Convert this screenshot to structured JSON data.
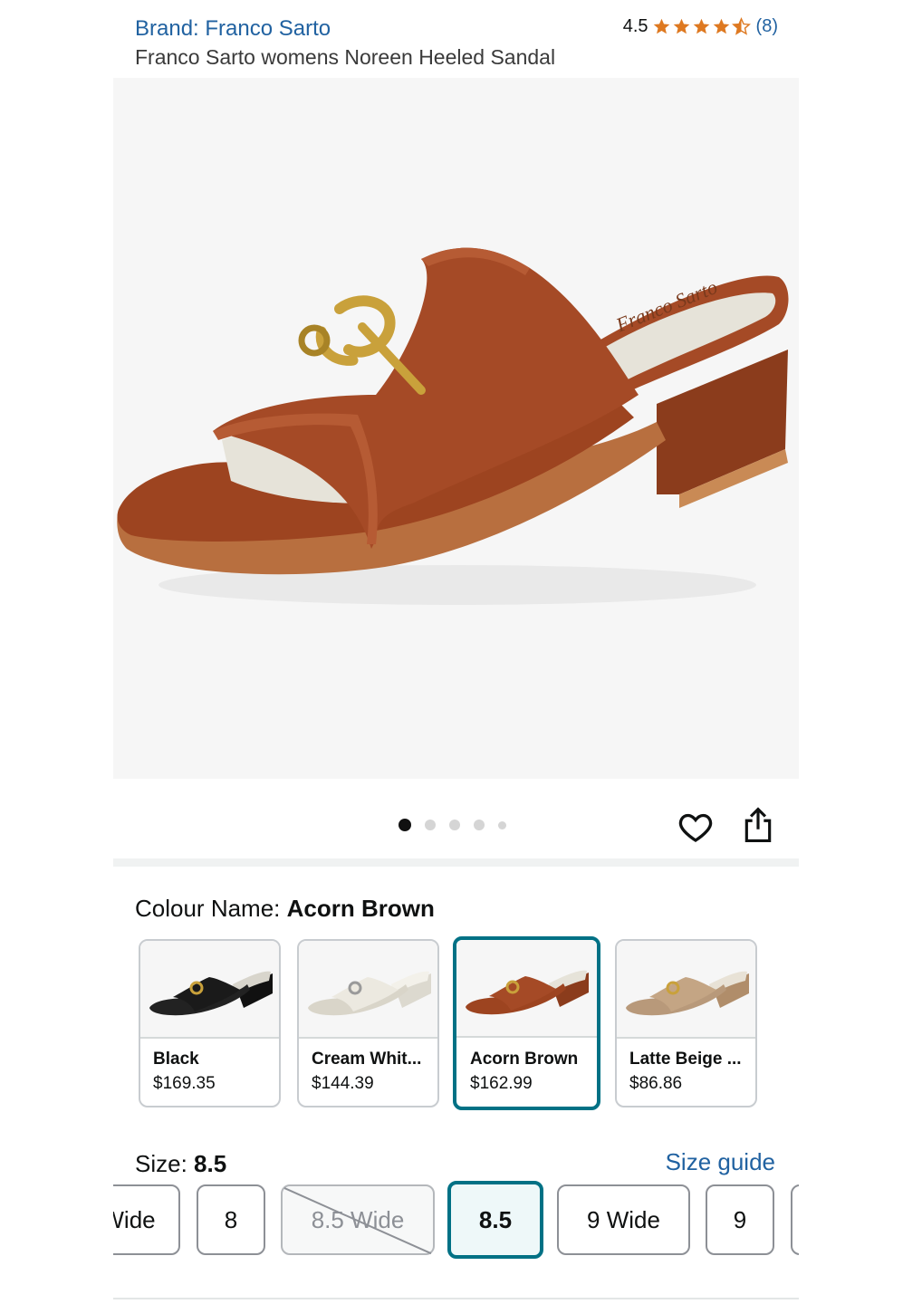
{
  "header": {
    "brand": "Brand: Franco Sarto",
    "title": "Franco Sarto womens Noreen Heeled Sandal",
    "rating_value": "4.5",
    "rating_count": "(8)",
    "stars": 4.5
  },
  "gallery": {
    "image_count": 5,
    "current_index": 1,
    "insole_text": "Franco Sarto"
  },
  "colour": {
    "label": "Colour Name: ",
    "selected": "Acorn Brown",
    "options": [
      {
        "name": "Black",
        "price": "$169.35",
        "color": "#1f1f1f"
      },
      {
        "name": "Cream Whit...",
        "price": "$144.39",
        "color": "#ece9e0"
      },
      {
        "name": "Acorn Brown",
        "price": "$162.99",
        "color": "#a54a26"
      },
      {
        "name": "Latte Beige ...",
        "price": "$86.86",
        "color": "#c4a584"
      }
    ]
  },
  "size": {
    "label": "Size: ",
    "selected": "8.5",
    "guide_label": "Size guide",
    "options": [
      {
        "label": "Wide",
        "state": "normal"
      },
      {
        "label": "8",
        "state": "normal"
      },
      {
        "label": "8.5 Wide",
        "state": "unavailable"
      },
      {
        "label": "8.5",
        "state": "selected"
      },
      {
        "label": "9 Wide",
        "state": "normal"
      },
      {
        "label": "9",
        "state": "normal"
      }
    ]
  },
  "colors": {
    "link": "#2162a1",
    "star": "#de7921",
    "selected_border": "#007185",
    "product": "#a54a26",
    "hardware": "#c9a13b"
  }
}
